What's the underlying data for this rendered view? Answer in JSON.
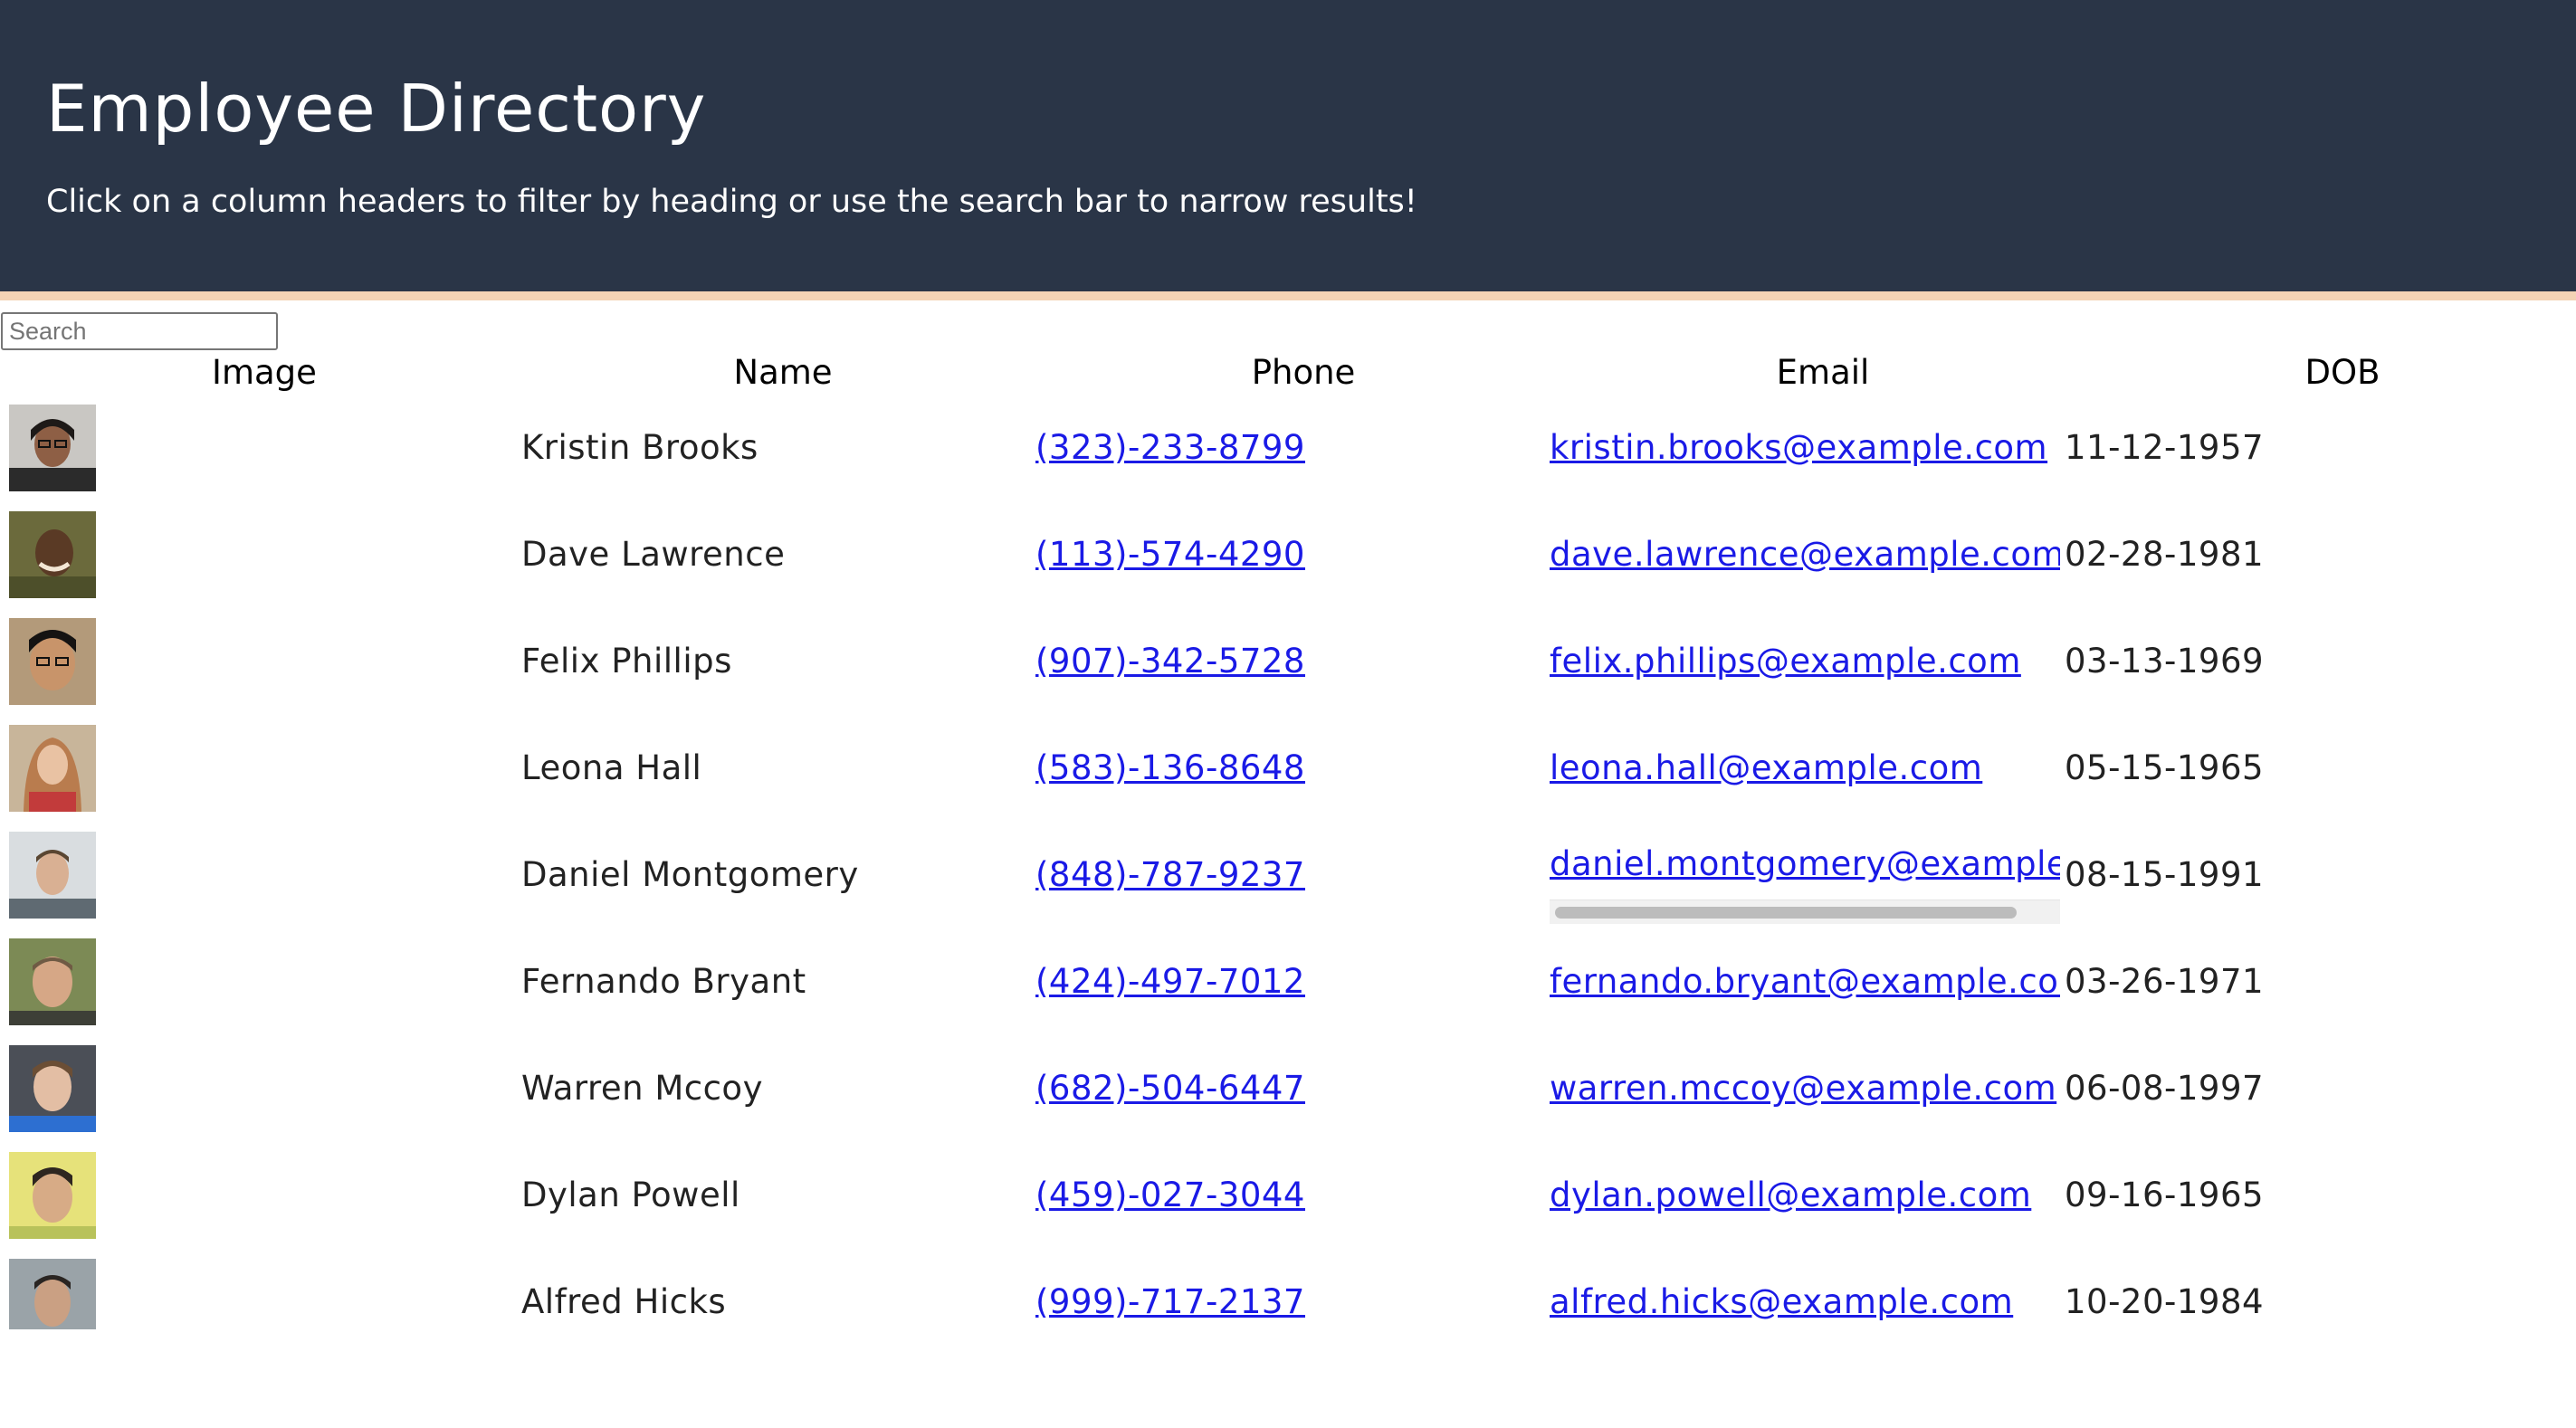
{
  "header": {
    "title": "Employee Directory",
    "subtitle": "Click on a column headers to filter by heading or use the search bar to narrow results!"
  },
  "search": {
    "placeholder": "Search",
    "value": ""
  },
  "table": {
    "columns": [
      "Image",
      "Name",
      "Phone",
      "Email",
      "DOB"
    ],
    "rows": [
      {
        "name": "Kristin Brooks",
        "phone": "(323)-233-8799",
        "email": "kristin.brooks@example.com",
        "dob": "11-12-1957"
      },
      {
        "name": "Dave Lawrence",
        "phone": "(113)-574-4290",
        "email": "dave.lawrence@example.com",
        "dob": "02-28-1981"
      },
      {
        "name": "Felix Phillips",
        "phone": "(907)-342-5728",
        "email": "felix.phillips@example.com",
        "dob": "03-13-1969"
      },
      {
        "name": "Leona Hall",
        "phone": "(583)-136-8648",
        "email": "leona.hall@example.com",
        "dob": "05-15-1965"
      },
      {
        "name": "Daniel Montgomery",
        "phone": "(848)-787-9237",
        "email": "daniel.montgomery@example.com",
        "dob": "08-15-1991"
      },
      {
        "name": "Fernando Bryant",
        "phone": "(424)-497-7012",
        "email": "fernando.bryant@example.com",
        "dob": "03-26-1971"
      },
      {
        "name": "Warren Mccoy",
        "phone": "(682)-504-6447",
        "email": "warren.mccoy@example.com",
        "dob": "06-08-1997"
      },
      {
        "name": "Dylan Powell",
        "phone": "(459)-027-3044",
        "email": "dylan.powell@example.com",
        "dob": "09-16-1965"
      },
      {
        "name": "Alfred Hicks",
        "phone": "(999)-717-2137",
        "email": "alfred.hicks@example.com",
        "dob": "10-20-1984"
      }
    ]
  },
  "colors": {
    "header_bg": "#2a3547",
    "header_accent": "#f3d3b5",
    "link": "#1a1ae6"
  }
}
